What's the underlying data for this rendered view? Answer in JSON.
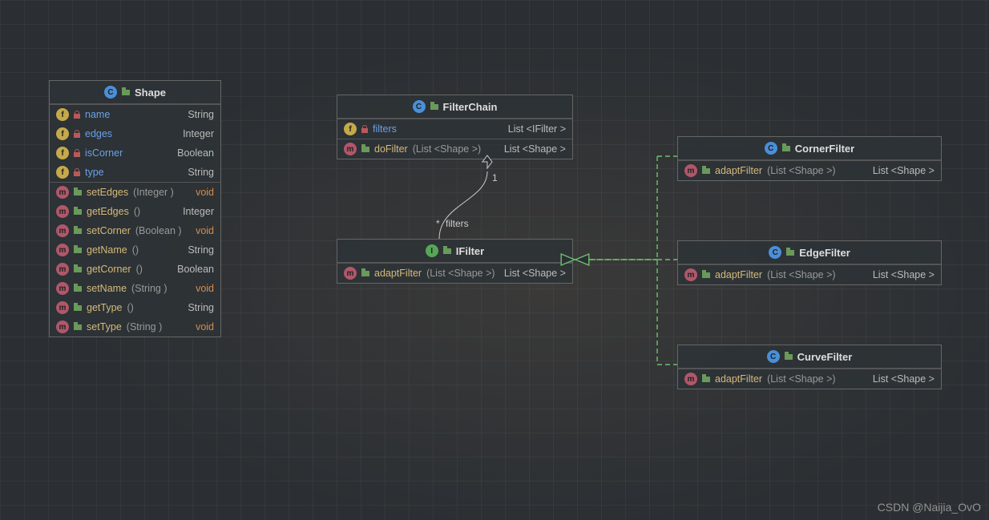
{
  "watermark": "CSDN @Naijia_OvO",
  "edgeLabels": {
    "one": "1",
    "filters": "filters",
    "star": "*"
  },
  "classes": {
    "shape": {
      "kind": "C",
      "name": "Shape",
      "fields": [
        {
          "icon": "f",
          "vis": "lock",
          "name": "name",
          "type": "String"
        },
        {
          "icon": "f",
          "vis": "lock",
          "name": "edges",
          "type": "Integer"
        },
        {
          "icon": "f",
          "vis": "lock",
          "name": "isCorner",
          "type": "Boolean"
        },
        {
          "icon": "f",
          "vis": "lock",
          "name": "type",
          "type": "String"
        }
      ],
      "methods": [
        {
          "name": "setEdges",
          "params": "(Integer )",
          "ret": "void",
          "retVoid": true
        },
        {
          "name": "getEdges",
          "params": "()",
          "ret": "Integer"
        },
        {
          "name": "setCorner",
          "params": "(Boolean )",
          "ret": "void",
          "retVoid": true
        },
        {
          "name": "getName",
          "params": "()",
          "ret": "String"
        },
        {
          "name": "getCorner",
          "params": "()",
          "ret": "Boolean"
        },
        {
          "name": "setName",
          "params": "(String )",
          "ret": "void",
          "retVoid": true
        },
        {
          "name": "getType",
          "params": "()",
          "ret": "String"
        },
        {
          "name": "setType",
          "params": "(String )",
          "ret": "void",
          "retVoid": true
        }
      ]
    },
    "filterChain": {
      "kind": "C",
      "name": "FilterChain",
      "fields": [
        {
          "icon": "f",
          "vis": "lock",
          "name": "filters",
          "type": "List <IFilter >"
        }
      ],
      "methods": [
        {
          "name": "doFilter",
          "params": "(List <Shape >)",
          "ret": "List <Shape >"
        }
      ]
    },
    "ifilter": {
      "kind": "I",
      "name": "IFilter",
      "methods": [
        {
          "name": "adaptFilter",
          "params": "(List <Shape >)",
          "ret": "List <Shape >"
        }
      ]
    },
    "cornerFilter": {
      "kind": "C",
      "name": "CornerFilter",
      "methods": [
        {
          "name": "adaptFilter",
          "params": "(List <Shape >)",
          "ret": "List <Shape >"
        }
      ]
    },
    "edgeFilter": {
      "kind": "C",
      "name": "EdgeFilter",
      "methods": [
        {
          "name": "adaptFilter",
          "params": "(List <Shape >)",
          "ret": "List <Shape >"
        }
      ]
    },
    "curveFilter": {
      "kind": "C",
      "name": "CurveFilter",
      "methods": [
        {
          "name": "adaptFilter",
          "params": "(List <Shape >)",
          "ret": "List <Shape >"
        }
      ]
    }
  }
}
